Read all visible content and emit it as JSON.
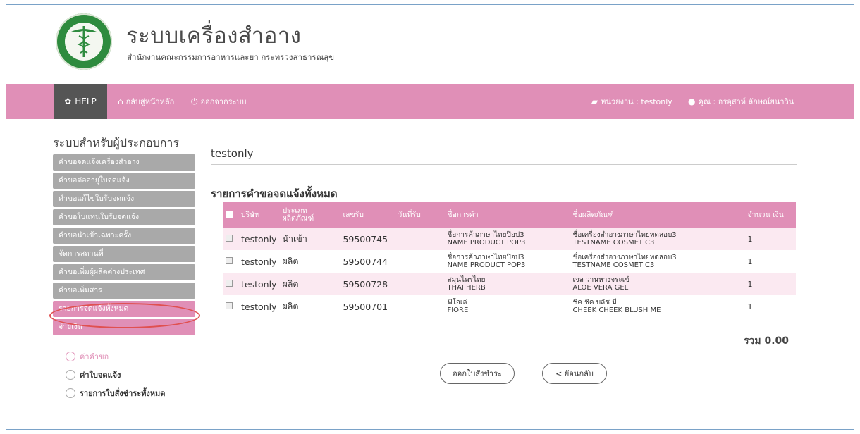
{
  "header": {
    "title": "ระบบเครื่องสำอาง",
    "subtitle": "สำนักงานคณะกรรมการอาหารและยา กระทรวงสาธารณสุข"
  },
  "navbar": {
    "help": "HELP",
    "home": "กลับสู่หน้าหลัก",
    "logout": "ออกจากระบบ",
    "unit": "หน่วยงาน : testonly",
    "user": "คุณ : อรอุสาห์ ลักษณ์ยนาวิน"
  },
  "sidebar": {
    "heading": "ระบบสำหรับผู้ประกอบการ",
    "items": [
      {
        "label": "คำขอจดแจ้งเครื่องสำอาง"
      },
      {
        "label": "คำขอต่ออายุใบจดแจ้ง"
      },
      {
        "label": "คำขอแก้ไขใบรับจดแจ้ง"
      },
      {
        "label": "คำขอใบแทนใบรับจดแจ้ง"
      },
      {
        "label": "คำขอนำเข้าเฉพาะครั้ง"
      },
      {
        "label": "จัดการสถานที่"
      },
      {
        "label": "คำขอเพิ่มผู้ผลิตต่างประเทศ"
      },
      {
        "label": "คำขอเพิ่มสาร"
      },
      {
        "label": "รายการจดแจ้งทั้งหมด"
      },
      {
        "label": "จ่ายเงิน"
      }
    ],
    "steps": [
      "ค่าคำขอ",
      "ค่าใบจดแจ้ง",
      "รายการใบสั่งชำระทั้งหมด"
    ]
  },
  "main": {
    "org_title": "testonly",
    "section_title": "รายการคำขอจดแจ้งทั้งหมด",
    "columns": [
      "บริษัท",
      "ประเภท ผลิตภัณฑ์",
      "เลขรับ",
      "วันที่รับ",
      "ชื่อการค้า",
      "ชื่อผลิตภัณฑ์",
      "จำนวน เงิน"
    ],
    "rows": [
      {
        "company": "testonly",
        "type": "นำเข้า",
        "number": "59500745",
        "date": "",
        "trade_th": "ชื่อการค้าภาษาไทยป๊อป3",
        "trade_en": "NAME PRODUCT POP3",
        "product_th": "ชื่อเครื่องสำอางภาษาไทยทดลอบ3",
        "product_en": "TESTNAME COSMETIC3",
        "amount": "1"
      },
      {
        "company": "testonly",
        "type": "ผลิต",
        "number": "59500744",
        "date": "",
        "trade_th": "ชื่อการค้าภาษาไทยป๊อป3",
        "trade_en": "NAME PRODUCT POP3",
        "product_th": "ชื่อเครื่องสำอางภาษาไทยทดลอบ3",
        "product_en": "TESTNAME COSMETIC3",
        "amount": "1"
      },
      {
        "company": "testonly",
        "type": "ผลิต",
        "number": "59500728",
        "date": "",
        "trade_th": "สมุนไพรไทย",
        "trade_en": "THAI HERB",
        "product_th": "เจล ว่านหางจระเข้",
        "product_en": "ALOE VERA GEL",
        "amount": "1"
      },
      {
        "company": "testonly",
        "type": "ผลิต",
        "number": "59500701",
        "date": "",
        "trade_th": "ฟิโอเล่",
        "trade_en": "FIORE",
        "product_th": "ชิค ชิค บลัช มี",
        "product_en": "CHEEK CHEEK BLUSH ME",
        "amount": "1"
      }
    ],
    "total_label": "รวม",
    "total_value": "0.00",
    "btn_invoice": "ออกใบสั่งชำระ",
    "btn_back": "< ย้อนกลับ"
  },
  "colors": {
    "accent": "#e08fb7",
    "nav_dark": "#555555",
    "side_gray": "#a9a9a9",
    "highlight": "#e05050"
  }
}
